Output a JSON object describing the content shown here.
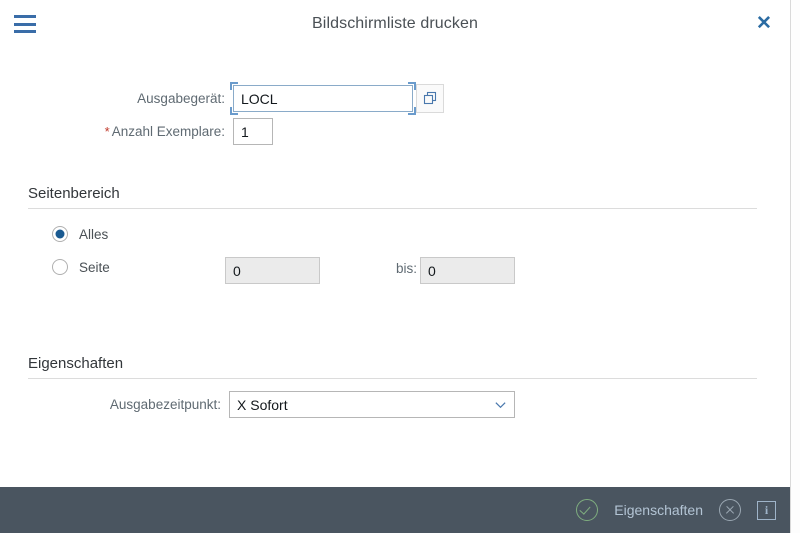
{
  "window": {
    "title": "Bildschirmliste drucken",
    "menu_icon": "hamburger-icon",
    "close_icon": "close-icon"
  },
  "form": {
    "output_device": {
      "label": "Ausgabegerät:",
      "value": "LOCL",
      "value_help_icon": "value-help-icon",
      "focused": true
    },
    "copies": {
      "required_marker": "*",
      "label": "Anzahl Exemplare:",
      "value": "1"
    }
  },
  "page_range": {
    "heading": "Seitenbereich",
    "options": [
      {
        "label": "Alles",
        "selected": true
      },
      {
        "label": "Seite",
        "selected": false
      }
    ],
    "from_value": "0",
    "to_label": "bis:",
    "to_value": "0",
    "inputs_disabled": true
  },
  "properties": {
    "heading": "Eigenschaften",
    "output_time": {
      "label": "Ausgabezeitpunkt:",
      "value": "X Sofort",
      "chevron_icon": "chevron-down-icon"
    }
  },
  "footer": {
    "ok_icon": "check-circle-icon",
    "properties_label": "Eigenschaften",
    "cancel_icon": "cancel-circle-icon",
    "info_icon": "info-icon"
  },
  "colors": {
    "accent": "#2b6ca3",
    "footer_bg": "#4a5560",
    "required": "#c0392b",
    "radio_selected": "#1a5a91",
    "ok_green": "#7fae7f"
  }
}
